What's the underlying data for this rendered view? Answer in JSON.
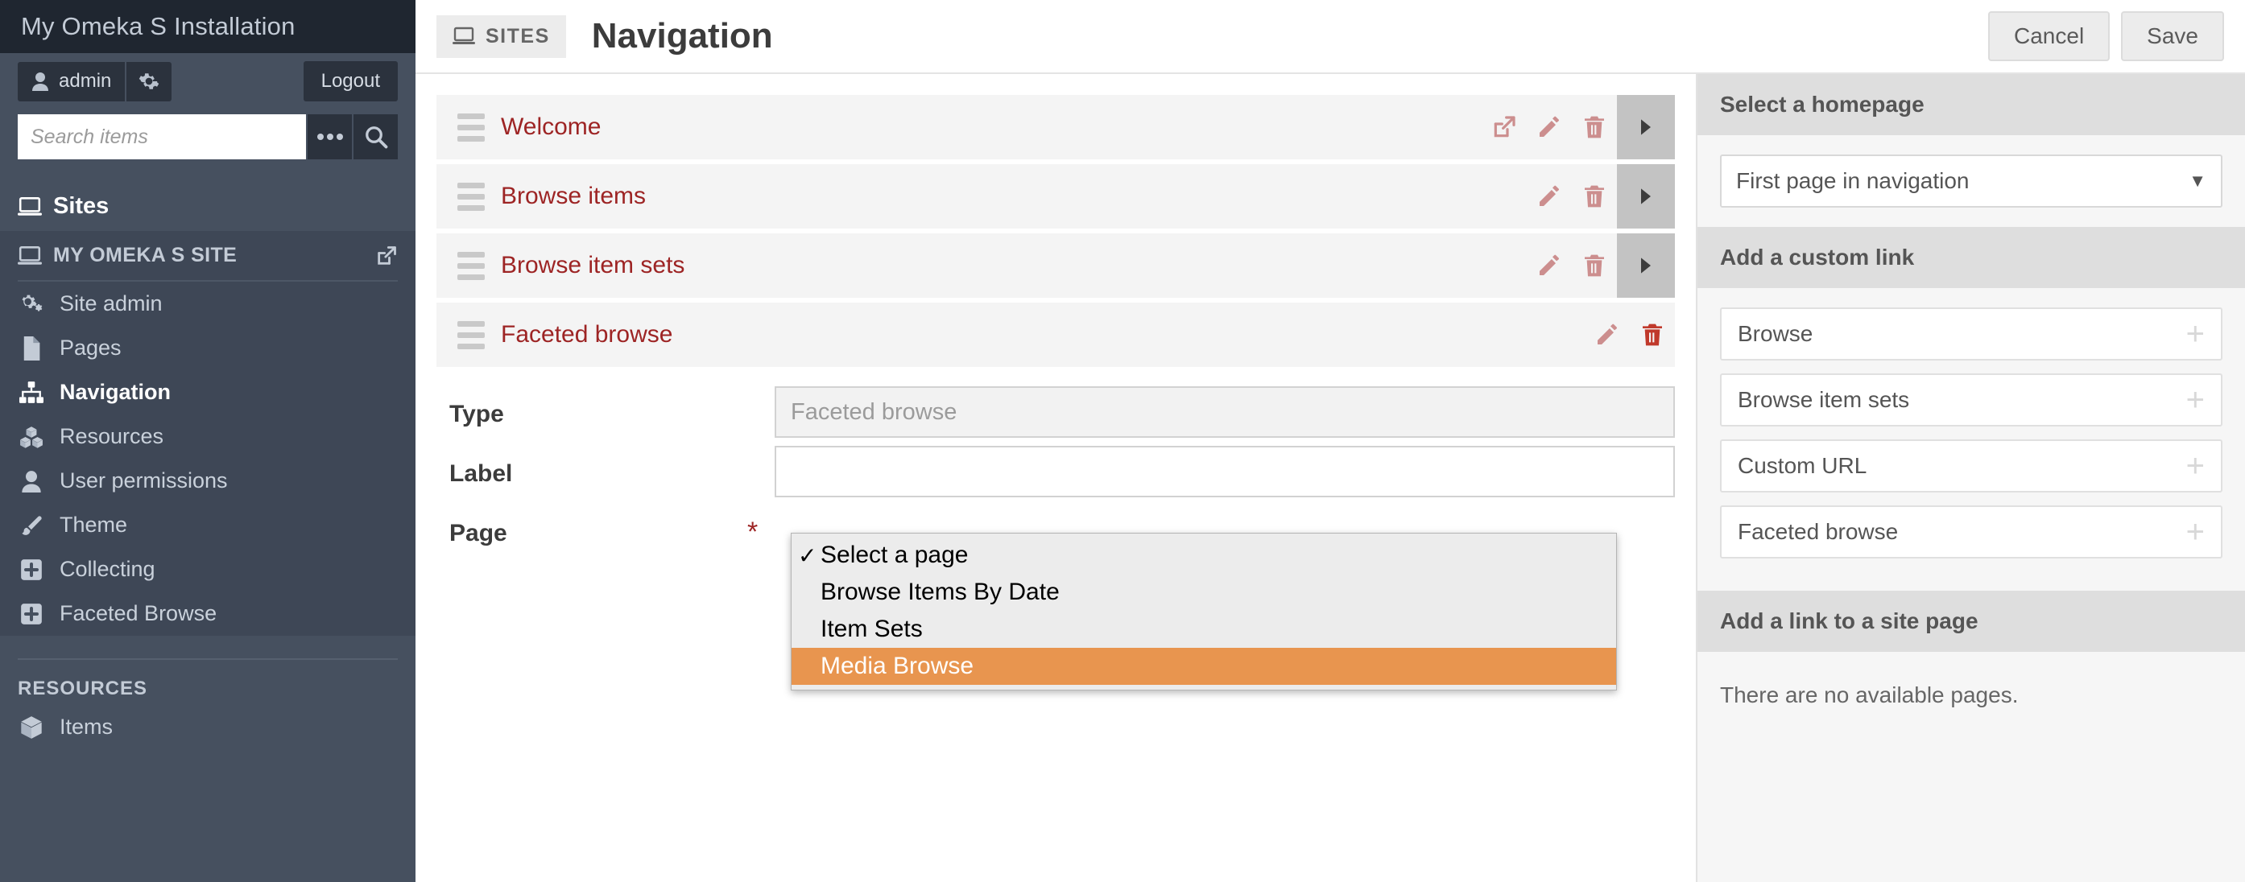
{
  "sidebar": {
    "installation_title": "My Omeka S Installation",
    "user": {
      "name": "admin",
      "gear_icon": "gear-icon",
      "user_icon": "user-icon"
    },
    "logout_label": "Logout",
    "search": {
      "placeholder": "Search items",
      "value": "",
      "more_icon": "ellipsis-icon",
      "search_icon": "search-icon"
    },
    "sites_section": {
      "label": "Sites",
      "icon": "laptop-icon"
    },
    "site": {
      "name": "MY OMEKA S SITE",
      "icon": "laptop-icon",
      "external_icon": "external-link-icon"
    },
    "items": [
      {
        "label": "Site admin",
        "icon": "gears-icon",
        "active": false
      },
      {
        "label": "Pages",
        "icon": "page-icon",
        "active": false
      },
      {
        "label": "Navigation",
        "icon": "sitemap-icon",
        "active": true
      },
      {
        "label": "Resources",
        "icon": "cubes-icon",
        "active": false
      },
      {
        "label": "User permissions",
        "icon": "user-icon",
        "active": false
      },
      {
        "label": "Theme",
        "icon": "brush-icon",
        "active": false
      },
      {
        "label": "Collecting",
        "icon": "plus-square-icon",
        "active": false
      },
      {
        "label": "Faceted Browse",
        "icon": "plus-square-icon",
        "active": false
      }
    ],
    "resources_section": {
      "label": "RESOURCES"
    },
    "resources_items": [
      {
        "label": "Items",
        "icon": "cube-icon"
      }
    ]
  },
  "topbar": {
    "breadcrumb": "SITES",
    "breadcrumb_icon": "laptop-icon",
    "title": "Navigation",
    "cancel_label": "Cancel",
    "save_label": "Save"
  },
  "nav_editor": {
    "rows": [
      {
        "label": "Welcome",
        "has_external": true,
        "has_expander": true
      },
      {
        "label": "Browse items",
        "has_external": false,
        "has_expander": true
      },
      {
        "label": "Browse item sets",
        "has_external": false,
        "has_expander": true
      },
      {
        "label": "Faceted browse",
        "has_external": false,
        "has_expander": false
      }
    ],
    "form": {
      "type_label": "Type",
      "type_value": "Faceted browse",
      "label_label": "Label",
      "label_value": "",
      "page_label": "Page",
      "page_required_mark": "*"
    },
    "dropdown": {
      "options": [
        {
          "text": "Select a page",
          "checked": true,
          "highlighted": false
        },
        {
          "text": "Browse Items By Date",
          "checked": false,
          "highlighted": false
        },
        {
          "text": "Item Sets",
          "checked": false,
          "highlighted": false
        },
        {
          "text": "Media Browse",
          "checked": false,
          "highlighted": true
        }
      ],
      "check_glyph": "✓"
    }
  },
  "right_panel": {
    "homepage_section": {
      "heading": "Select a homepage",
      "selected": "First page in navigation",
      "caret_icon": "chevron-down-icon"
    },
    "custom_link_section": {
      "heading": "Add a custom link",
      "buttons": [
        {
          "label": "Browse",
          "icon": "plus-icon"
        },
        {
          "label": "Browse item sets",
          "icon": "plus-icon"
        },
        {
          "label": "Custom URL",
          "icon": "plus-icon"
        },
        {
          "label": "Faceted browse",
          "icon": "plus-icon"
        }
      ]
    },
    "site_page_section": {
      "heading": "Add a link to a site page",
      "empty_message": "There are no available pages."
    }
  },
  "colors": {
    "sidebar_bg": "#46505f",
    "sidebar_dark": "#1f2630",
    "link_red": "#9d2424",
    "icon_salmon": "#cc8e8e",
    "highlight_orange": "#e8954f"
  }
}
